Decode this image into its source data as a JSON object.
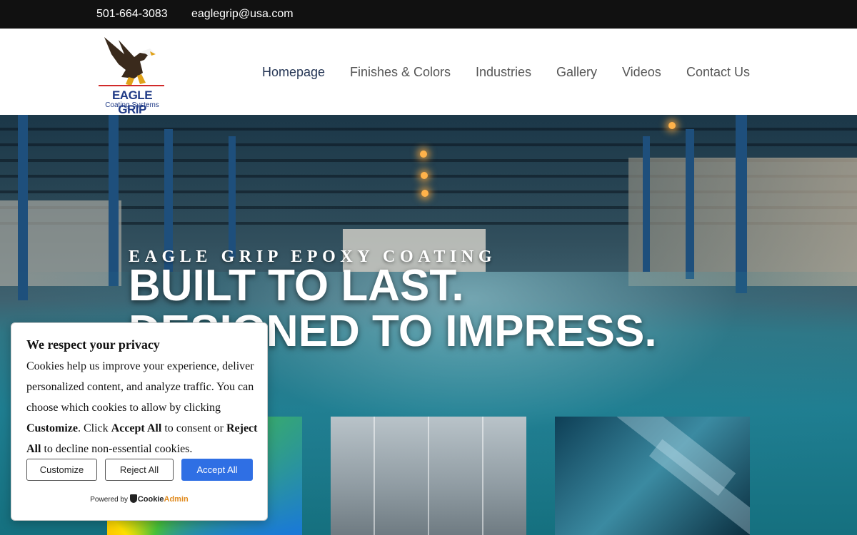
{
  "topbar": {
    "phone": "501-664-3083",
    "email": "eaglegrip@usa.com"
  },
  "logo": {
    "name": "EAGLE GRIP",
    "tagline": "Coating Systems"
  },
  "nav": {
    "items": [
      {
        "label": "Homepage",
        "active": true
      },
      {
        "label": "Finishes & Colors"
      },
      {
        "label": "Industries"
      },
      {
        "label": "Gallery"
      },
      {
        "label": "Videos"
      },
      {
        "label": "Contact Us"
      }
    ]
  },
  "hero": {
    "kicker": "EAGLE GRIP EPOXY COATING",
    "line1": "BUILT TO LAST.",
    "line2": "DESIGNED TO IMPRESS."
  },
  "cookie": {
    "title": "We respect your privacy",
    "body_1": "Cookies help us improve your experience, deliver personalized content, and analyze traffic. You can choose which cookies to allow by clicking ",
    "customize_word": "Customize",
    "body_2": ". Click ",
    "accept_word": "Accept All",
    "body_3": " to consent or ",
    "reject_word": "Reject All",
    "body_4": " to decline non-essential cookies.",
    "buttons": {
      "customize": "Customize",
      "reject": "Reject All",
      "accept": "Accept All"
    },
    "powered_by": "Powered by",
    "brand_a": "Cookie",
    "brand_b": "Admin"
  },
  "colors": {
    "topbar_bg": "#111111",
    "nav_active": "#243554",
    "accept_button": "#2f6fe4",
    "logo_blue": "#1f3a86"
  }
}
